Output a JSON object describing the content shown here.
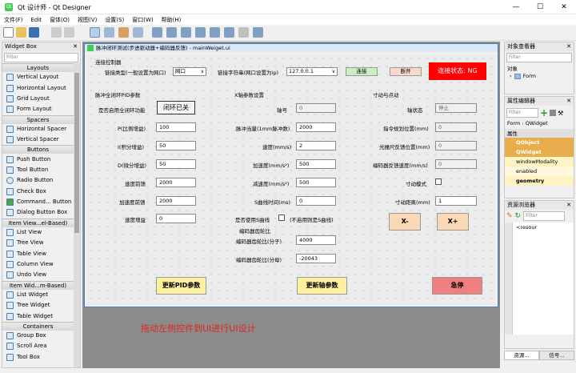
{
  "window": {
    "title": "Qt 设计师 - Qt Designer",
    "minimize": "—",
    "maximize": "☐",
    "close": "✕"
  },
  "menu": [
    "文件(F)",
    "Edit",
    "窗体(O)",
    "视图(V)",
    "设置(S)",
    "窗口(W)",
    "帮助(H)"
  ],
  "widget_box": {
    "title": "Widget Box",
    "filter_placeholder": "Filter",
    "categories": [
      {
        "name": "Layouts",
        "items": [
          "Vertical Layout",
          "Horizontal Layout",
          "Grid Layout",
          "Form Layout"
        ]
      },
      {
        "name": "Spacers",
        "items": [
          "Horizontal Spacer",
          "Vertical Spacer"
        ]
      },
      {
        "name": "Buttons",
        "items": [
          "Push Button",
          "Tool Button",
          "Radio Button",
          "Check Box",
          "Command... Button",
          "Dialog Button Box"
        ]
      },
      {
        "name": "Item View...el-Based)",
        "items": [
          "List View",
          "Tree View",
          "Table View",
          "Column View",
          "Undo View"
        ]
      },
      {
        "name": "Item Wid...m-Based)",
        "items": [
          "List Widget",
          "Tree Widget",
          "Table Widget"
        ]
      },
      {
        "name": "Containers",
        "items": [
          "Group Box",
          "Scroll Area",
          "Tool Box"
        ]
      }
    ]
  },
  "form": {
    "title": "脉冲闭环测试(步进驱动器+编码器反馈) - mainWeiget.ui",
    "connect_group": {
      "title": "连接控制器",
      "link_type_label": "链接类型(一般设置为网口)",
      "link_type_value": "网口",
      "link_str_label": "链接字符串(网口设置为ip)",
      "link_str_value": "127.0.0.1",
      "connect_btn": "连接",
      "disconnect_btn": "断开",
      "status": "连接状态: NG"
    },
    "pid_group": {
      "title": "脉冲全闭环PID参数",
      "enable_label": "是否启用全闭环功能",
      "toggle_btn": "闭环已关",
      "rows": [
        {
          "label": "P(比例增益)",
          "value": "100"
        },
        {
          "label": "I(积分增益)",
          "value": "50"
        },
        {
          "label": "D(微分增益)",
          "value": "50"
        },
        {
          "label": "速度前馈",
          "value": "2000"
        },
        {
          "label": "加速度前馈",
          "value": "2000"
        },
        {
          "label": "速度增益",
          "value": "0"
        }
      ],
      "update_btn": "更新PID参数"
    },
    "axis_group": {
      "title": "X轴参数设置",
      "rows": [
        {
          "label": "轴号",
          "value": "0"
        },
        {
          "label": "脉冲当量(1mm脉冲数)",
          "value": "2000"
        },
        {
          "label": "速度(mm/s)",
          "value": "2"
        },
        {
          "label": "加速度(mm/s²)",
          "value": "500"
        },
        {
          "label": "减速度(mm/s²)",
          "value": "500"
        },
        {
          "label": "S曲线时间(ms)",
          "value": "0"
        }
      ],
      "s_curve_label": "是否使用S曲线",
      "s_curve_note": "(不启用则是S曲线)",
      "ratio_title": "编码器齿轮比",
      "ratio_num_label": "编码器齿轮比(分子)",
      "ratio_num_value": "4000",
      "ratio_den_label": "编码器齿轮比(分母)",
      "ratio_den_value": "-20043",
      "update_btn": "更新轴参数"
    },
    "motion_group": {
      "title": "寸动与点动",
      "rows": [
        {
          "label": "轴状态",
          "value": "停止"
        },
        {
          "label": "指令规划位置(mm)",
          "value": "0"
        },
        {
          "label": "光栅尺反馈位置(mm)",
          "value": "0"
        },
        {
          "label": "编码器反馈速度(mm/s)",
          "value": "0"
        }
      ],
      "jog_mode_label": "寸动模式",
      "jog_dist_label": "寸动距离(mm)",
      "jog_dist_value": "1",
      "xminus_btn": "X-",
      "xplus_btn": "X+",
      "estop_btn": "急停"
    }
  },
  "annotation": "拖动左侧控件到UI进行UI设计",
  "object_inspector": {
    "title": "对象查看器",
    "filter_placeholder": "Filter",
    "header": "对象",
    "root": "Form"
  },
  "property_editor": {
    "title": "属性编辑器",
    "filter_placeholder": "Filter",
    "form_label": "Form : QWidget",
    "header": "属性",
    "rows": [
      {
        "name": "QObject",
        "kind": "class"
      },
      {
        "name": "QWidget",
        "kind": "class"
      },
      {
        "name": "windowModality",
        "kind": "prop"
      },
      {
        "name": "enabled",
        "kind": "prop"
      },
      {
        "name": "geometry",
        "kind": "prop"
      }
    ]
  },
  "resource_browser": {
    "title": "资源浏览器",
    "filter_placeholder": "Filter",
    "root": "<resour"
  },
  "bottom_tabs": [
    "资源...",
    "信号..."
  ],
  "colors": {
    "accent": "#41cd52",
    "status_red": "#ff0000",
    "pid_btn": "#fff0a0",
    "estop": "#f08080",
    "annotation": "#e2231a"
  }
}
